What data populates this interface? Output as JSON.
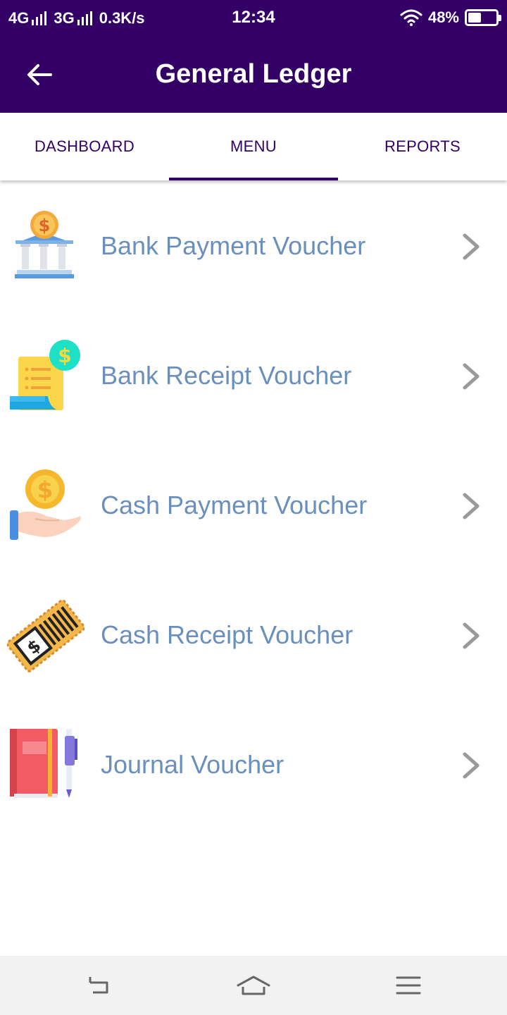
{
  "status_bar": {
    "network_1": "4G",
    "network_2": "3G",
    "speed": "0.3K/s",
    "time": "12:34",
    "battery": "48%",
    "battery_level": 0.48
  },
  "header": {
    "title": "General Ledger",
    "back_icon": "arrow-left-icon"
  },
  "tabs": [
    {
      "label": "DASHBOARD",
      "active": false
    },
    {
      "label": "MENU",
      "active": true
    },
    {
      "label": "REPORTS",
      "active": false
    }
  ],
  "menu": {
    "items": [
      {
        "label": "Bank Payment Voucher",
        "icon": "bank-icon"
      },
      {
        "label": "Bank Receipt Voucher",
        "icon": "receipt-icon"
      },
      {
        "label": "Cash Payment Voucher",
        "icon": "cash-hand-icon"
      },
      {
        "label": "Cash Receipt Voucher",
        "icon": "ticket-icon"
      },
      {
        "label": "Journal Voucher",
        "icon": "journal-icon"
      }
    ]
  },
  "colors": {
    "primary": "#330066",
    "label": "#6a8fbc",
    "chevron": "#9a9a9a",
    "nav_bg": "#f2f2f2"
  },
  "system_nav": [
    "back-icon",
    "home-icon",
    "menu-icon"
  ]
}
